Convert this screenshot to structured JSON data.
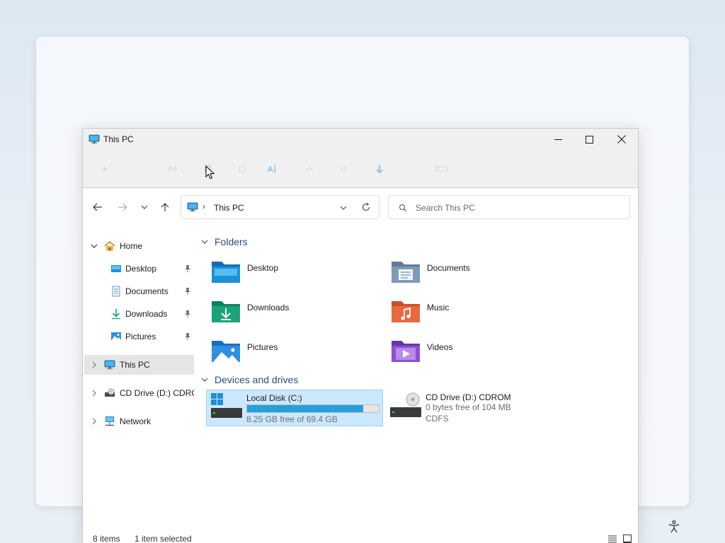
{
  "window": {
    "title": "This PC"
  },
  "command_bar": {
    "icons": [
      "new-icon",
      "cut-icon",
      "copy-icon",
      "paste-icon",
      "rename-icon",
      "share-icon",
      "delete-icon",
      "sort-icon",
      "view-icon"
    ]
  },
  "address": {
    "separator": "›",
    "location": "This PC"
  },
  "search": {
    "placeholder": "Search This PC"
  },
  "sidebar": {
    "home_label": "Home",
    "quick_access": [
      {
        "label": "Desktop",
        "icon": "desktop-icon"
      },
      {
        "label": "Documents",
        "icon": "documents-icon"
      },
      {
        "label": "Downloads",
        "icon": "downloads-icon"
      },
      {
        "label": "Pictures",
        "icon": "pictures-icon"
      }
    ],
    "this_pc_label": "This PC",
    "cd_drive_label": "CD Drive (D:) CDROM",
    "network_label": "Network"
  },
  "sections": {
    "folders_label": "Folders",
    "devices_label": "Devices and drives"
  },
  "folders": [
    {
      "label": "Desktop",
      "color": "#1e90d6"
    },
    {
      "label": "Documents",
      "color": "#7f9bb8"
    },
    {
      "label": "Downloads",
      "color": "#1aa37a"
    },
    {
      "label": "Music",
      "color": "#e86a3c"
    },
    {
      "label": "Pictures",
      "color": "#2f8fe0"
    },
    {
      "label": "Videos",
      "color": "#8e4fd6"
    }
  ],
  "drives": [
    {
      "name": "Local Disk (C:)",
      "free_text": "8.25 GB free of 69.4 GB",
      "used_fraction": 0.88,
      "selected": true
    },
    {
      "name": "CD Drive (D:) CDROM",
      "free_text": "0 bytes free of 104 MB",
      "fs": "CDFS",
      "selected": false
    }
  ],
  "status": {
    "items": "8 items",
    "selected": "1 item selected"
  },
  "colors": {
    "accent": "#26a0da",
    "selection": "#cce8ff",
    "section_text": "#2b4e7a"
  }
}
